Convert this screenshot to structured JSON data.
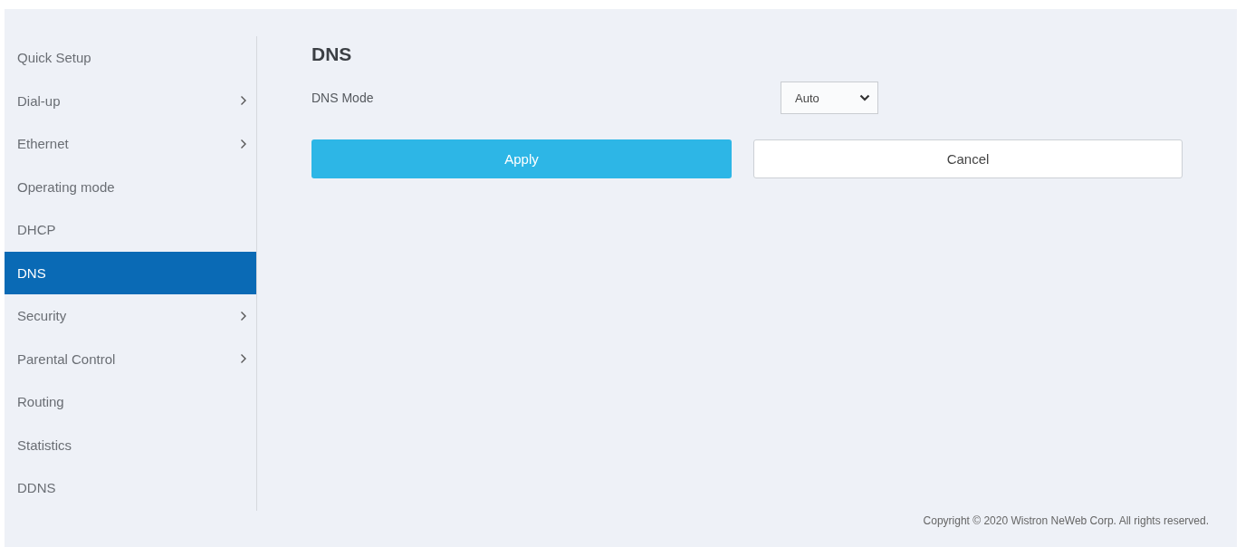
{
  "sidebar": {
    "items": [
      {
        "label": "Quick Setup",
        "has_submenu": false,
        "selected": false
      },
      {
        "label": "Dial-up",
        "has_submenu": true,
        "selected": false
      },
      {
        "label": "Ethernet",
        "has_submenu": true,
        "selected": false
      },
      {
        "label": "Operating mode",
        "has_submenu": false,
        "selected": false
      },
      {
        "label": "DHCP",
        "has_submenu": false,
        "selected": false
      },
      {
        "label": "DNS",
        "has_submenu": false,
        "selected": true
      },
      {
        "label": "Security",
        "has_submenu": true,
        "selected": false
      },
      {
        "label": "Parental Control",
        "has_submenu": true,
        "selected": false
      },
      {
        "label": "Routing",
        "has_submenu": false,
        "selected": false
      },
      {
        "label": "Statistics",
        "has_submenu": false,
        "selected": false
      },
      {
        "label": "DDNS",
        "has_submenu": false,
        "selected": false
      }
    ]
  },
  "content": {
    "title": "DNS",
    "fields": [
      {
        "label": "DNS Mode",
        "value": "Auto"
      }
    ],
    "buttons": [
      {
        "label": "Apply",
        "kind": "primary"
      },
      {
        "label": "Cancel",
        "kind": "secondary"
      }
    ]
  },
  "footer": "Copyright © 2020 Wistron NeWeb Corp. All rights reserved."
}
